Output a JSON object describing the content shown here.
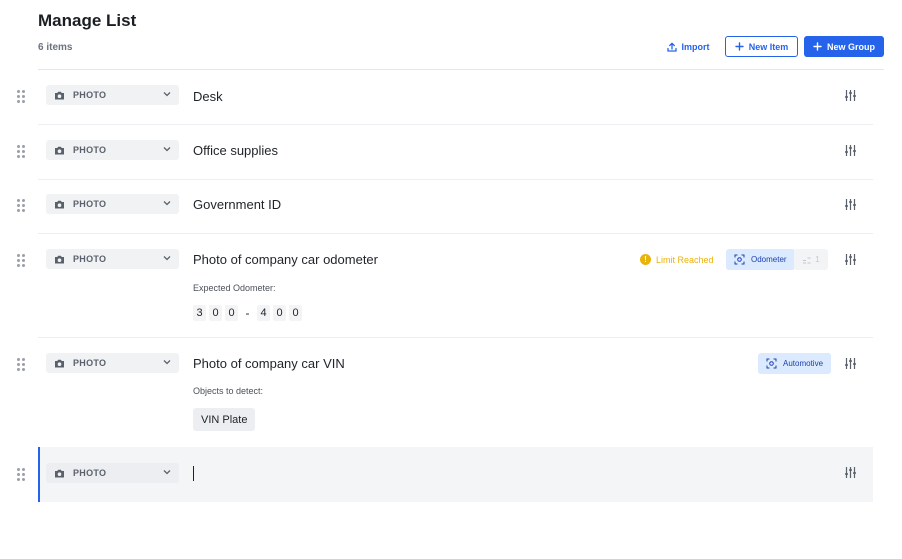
{
  "page": {
    "title": "Manage List",
    "item_count": "6 items"
  },
  "toolbar": {
    "import_label": "Import",
    "new_item_label": "New Item",
    "new_group_label": "New Group",
    "accent_color": "#2563eb"
  },
  "items": [
    {
      "type": "PHOTO",
      "name": "Desk",
      "icon": "camera-icon"
    },
    {
      "type": "PHOTO",
      "name": "Office supplies",
      "icon": "camera-icon"
    },
    {
      "type": "PHOTO",
      "name": "Government ID",
      "icon": "camera-icon"
    },
    {
      "type": "PHOTO",
      "name": "Photo of company car odometer",
      "icon": "camera-icon",
      "limit_label": "Limit Reached",
      "detector_tag": "Odometer",
      "count": "1",
      "sub_label": "Expected Odometer:",
      "odometer_min": [
        "3",
        "0",
        "0"
      ],
      "odometer_separator": "-",
      "odometer_max": [
        "4",
        "0",
        "0"
      ]
    },
    {
      "type": "PHOTO",
      "name": "Photo of company car VIN",
      "icon": "camera-icon",
      "detector_tag": "Automotive",
      "sub_label": "Objects to detect:",
      "objects": [
        "VIN Plate"
      ]
    },
    {
      "type": "PHOTO",
      "name": "",
      "icon": "camera-icon",
      "editing": true
    }
  ]
}
